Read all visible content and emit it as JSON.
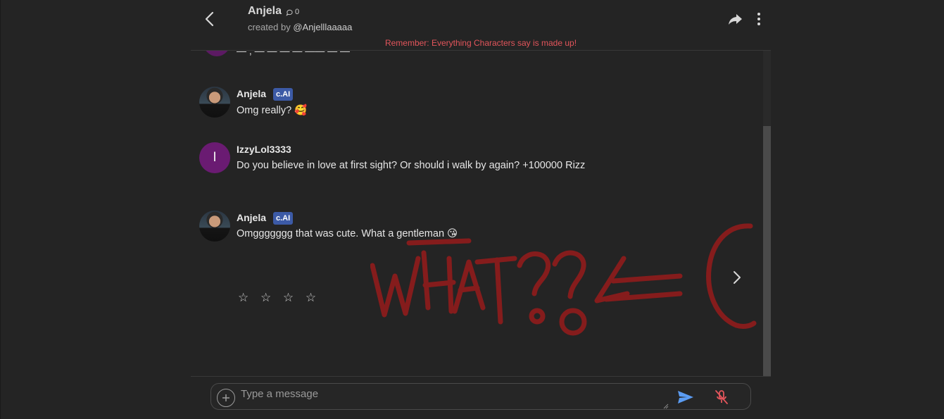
{
  "header": {
    "character_name": "Anjela",
    "chat_count": "0",
    "created_by_label": "created by",
    "creator_handle": "@Anjelllaaaaa",
    "disclaimer": "Remember: Everything Characters say is made up!"
  },
  "messages": [
    {
      "sender": "Anjela",
      "badge": "c.AI",
      "text": "Omg really? 🥰",
      "avatar": "photo"
    },
    {
      "sender": "IzzyLol3333",
      "badge": "",
      "avatar_letter": "I",
      "text": "Do you believe in love at first sight? Or should i walk by again?  +100000 Rizz"
    },
    {
      "sender": "Anjela",
      "badge": "c.AI",
      "text": "Omggggggg that was cute.  What a gentleman 😘",
      "avatar": "photo"
    }
  ],
  "rating": {
    "stars": "☆ ☆ ☆ ☆",
    "value": 0,
    "max": 4
  },
  "input": {
    "placeholder": "Type a message",
    "value": ""
  },
  "colors": {
    "background": "#242424",
    "disclaimer": "#e2555b",
    "badge": "#3c5aa6",
    "avatar_letter_bg": "#6a1b72",
    "send_icon": "#5b9cf2",
    "mic_off_icon": "#e2555b",
    "scribble": "#8b1c1c"
  },
  "icons": {
    "back": "chevron-left-icon",
    "chat_count": "chat-bubble-icon",
    "share": "share-icon",
    "more": "more-vertical-icon",
    "next": "chevron-right-icon",
    "add": "plus-circle-icon",
    "send": "send-icon",
    "mic": "mic-off-icon"
  }
}
